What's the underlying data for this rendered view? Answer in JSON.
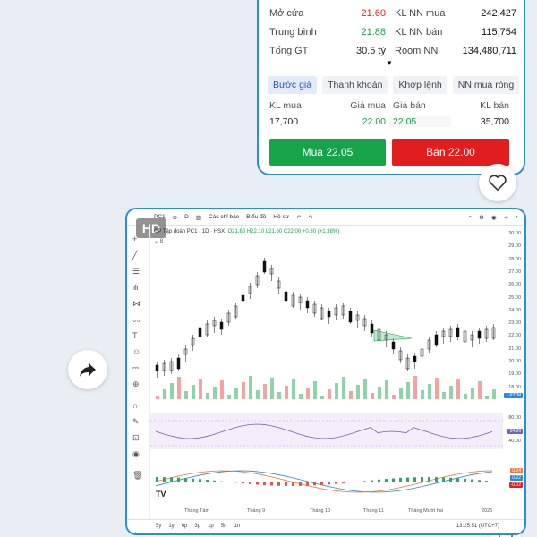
{
  "stats": {
    "rows": [
      {
        "l1": "Mở cửa",
        "v1": "21.60",
        "c1": "red",
        "l2": "KL NN mua",
        "v2": "242,427"
      },
      {
        "l1": "Trung bình",
        "v1": "21.88",
        "c1": "green",
        "l2": "KL NN bán",
        "v2": "115,754"
      },
      {
        "l1": "Tổng GT",
        "v1": "30.5 tỷ",
        "c1": "",
        "l2": "Room NN",
        "v2": "134,480,711"
      }
    ]
  },
  "tabs": [
    "Bước giá",
    "Thanh khoản",
    "Khớp lệnh",
    "NN mua ròng"
  ],
  "orderbook": {
    "headers": [
      "KL mua",
      "Giá mua",
      "Giá bán",
      "KL bán"
    ],
    "values": [
      "17,700",
      "22.00",
      "22.05",
      "35,700"
    ]
  },
  "buttons": {
    "buy": "Mua 22.05",
    "sell": "Bán 22.00"
  },
  "chart_card": {
    "hd_badge": "HD",
    "toolbar": [
      "PC1",
      "D",
      "Các chỉ báo",
      "Biểu đồ",
      "Hồ sơ"
    ],
    "legend": "CP Tập đoàn PC1 · 1D · HSX",
    "ohlc": "O21.60 H22.10 L21.60 C22.00 +0.30 (+1.38%)",
    "count_label": "8",
    "ranges": [
      "5y",
      "1y",
      "6p",
      "3p",
      "1p",
      "5n",
      "1n"
    ],
    "clock": "13:25:51 (UTC+7)",
    "rsi_value": "54.96",
    "macd_values": [
      "0.24",
      "0.22",
      "-0.02"
    ],
    "volume_value": "1.637M",
    "price_axis": [
      "30.00",
      "29.00",
      "28.00",
      "27.00",
      "26.00",
      "25.00",
      "24.00",
      "23.00",
      "22.00",
      "21.00",
      "20.00",
      "19.00",
      "18.00"
    ],
    "rsi_axis": [
      "80.00",
      "54.96",
      "40.00"
    ],
    "date_axis": [
      "Tháng Tám",
      "Tháng 9",
      "Tháng 10",
      "Tháng 11",
      "Tháng Mười hai",
      "2026"
    ]
  },
  "colors": {
    "up": "#16a34a",
    "down": "#e02424",
    "accent": "#2b8fd6"
  }
}
